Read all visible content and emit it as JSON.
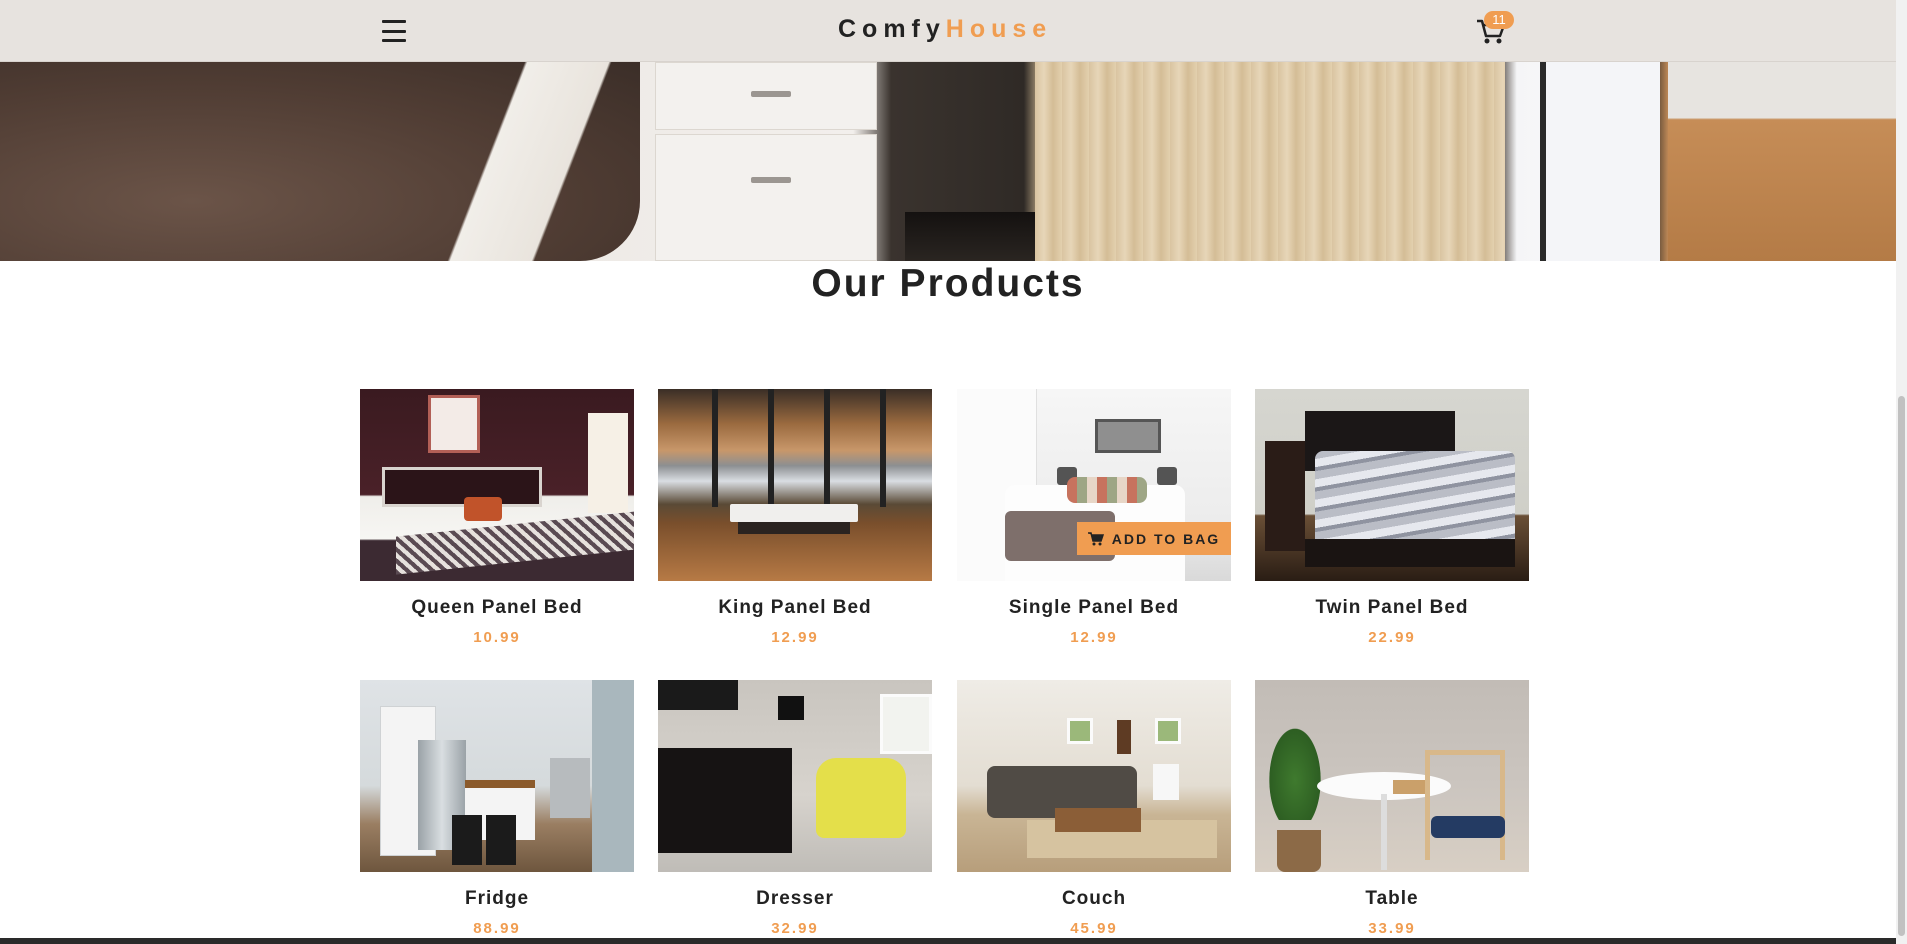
{
  "navbar": {
    "logo_part1": "Comfy",
    "logo_part2": "House",
    "cart_count": "11",
    "menu_icon": "hamburger-menu-icon",
    "cart_icon": "shopping-cart-icon"
  },
  "section": {
    "title": "Our Products"
  },
  "products": [
    {
      "name": "Queen Panel Bed",
      "price": "10.99"
    },
    {
      "name": "King Panel Bed",
      "price": "12.99"
    },
    {
      "name": "Single Panel Bed",
      "price": "12.99"
    },
    {
      "name": "Twin Panel Bed",
      "price": "22.99"
    },
    {
      "name": "Fridge",
      "price": "88.99"
    },
    {
      "name": "Dresser",
      "price": "32.99"
    },
    {
      "name": "Couch",
      "price": "45.99"
    },
    {
      "name": "Table",
      "price": "33.99"
    }
  ],
  "bag_button": {
    "label": "ADD TO BAG",
    "icon": "shopping-cart-icon"
  },
  "colors": {
    "accent": "#f09d51",
    "navbar_bg": "#e7e3df",
    "text": "#222222"
  }
}
